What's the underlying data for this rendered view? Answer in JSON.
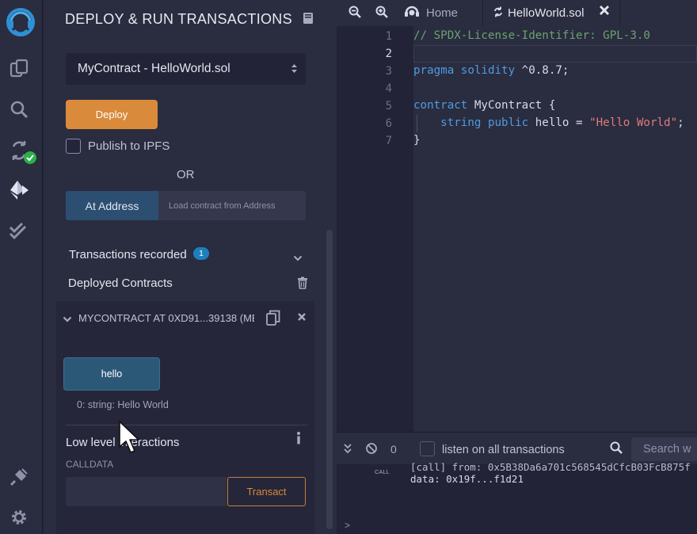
{
  "rail": {
    "icons": [
      "remix-logo-icon",
      "file-explorer-icon",
      "search-icon",
      "solidity-compiler-icon",
      "deploy-run-icon",
      "test-check-icon",
      "plugin-manager-icon",
      "settings-gear-icon"
    ]
  },
  "panel": {
    "title": "DEPLOY & RUN TRANSACTIONS",
    "contract_select": "MyContract - HelloWorld.sol",
    "deploy_label": "Deploy",
    "publish_label": "Publish to IPFS",
    "or_label": "OR",
    "at_address_label": "At Address",
    "load_placeholder": "Load contract from Address",
    "transactions_recorded_label": "Transactions recorded",
    "transactions_count": "1",
    "deployed_contracts_label": "Deployed Contracts",
    "instance": {
      "title": "MYCONTRACT AT 0XD91...39138 (ME",
      "hello_button": "hello",
      "result": "0: string: Hello World",
      "low_level_label": "Low level interactions",
      "calldata_label": "CALLDATA",
      "transact_label": "Transact"
    }
  },
  "tabs": {
    "home": "Home",
    "file": "HelloWorld.sol"
  },
  "editor": {
    "line_numbers": [
      "1",
      "2",
      "3",
      "4",
      "5",
      "6",
      "7"
    ],
    "lines": [
      "// SPDX-License-Identifier: GPL-3.0",
      "",
      "pragma solidity ^0.8.7;",
      "",
      "contract MyContract {",
      "    string public hello = \"Hello World\";",
      "}"
    ]
  },
  "terminal": {
    "pending_count": "0",
    "listen_label": "listen on all transactions",
    "search_placeholder": "Search w",
    "call_tag": "CALL",
    "line1": "[call] from: 0x5B38Da6a701c568545dCfcB03FcB875f",
    "line2": "data: 0x19f...f1d21",
    "prompt": ">"
  },
  "colors": {
    "accent_orange": "#d98a3a",
    "accent_blue": "#2c4f71",
    "badge_blue": "#1d7fbd",
    "success_green": "#2bb04a"
  }
}
